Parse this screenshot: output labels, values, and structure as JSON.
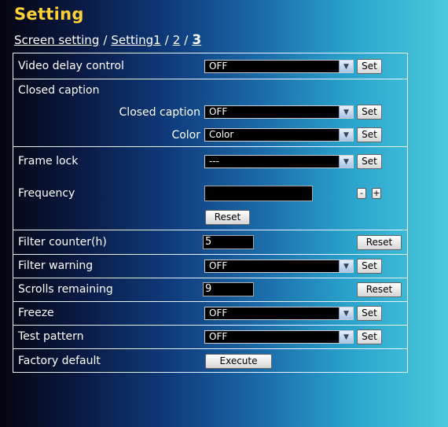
{
  "header": {
    "title": "Setting",
    "breadcrumb": {
      "link1": "Screen setting",
      "sep1": "/",
      "link2": "Setting1",
      "sep2": "/",
      "link3": "2",
      "sep3": "/",
      "current": "3"
    }
  },
  "rows": {
    "video_delay": {
      "label": "Video delay control",
      "value": "OFF",
      "set": "Set"
    },
    "closed_caption": {
      "label": "Closed caption",
      "sub_cc": {
        "label": "Closed caption",
        "value": "OFF",
        "set": "Set"
      },
      "sub_color": {
        "label": "Color",
        "value": "Color",
        "set": "Set"
      }
    },
    "frame_lock": {
      "label": "Frame lock",
      "value": "---",
      "set": "Set"
    },
    "frequency": {
      "label": "Frequency",
      "value": "",
      "minus": "-",
      "plus": "+",
      "reset": "Reset"
    },
    "filter_counter": {
      "label": "Filter counter(h)",
      "value": "5",
      "reset": "Reset"
    },
    "filter_warning": {
      "label": "Filter warning",
      "value": "OFF",
      "set": "Set"
    },
    "scrolls_remaining": {
      "label": "Scrolls remaining",
      "value": "9",
      "reset": "Reset"
    },
    "freeze": {
      "label": "Freeze",
      "value": "OFF",
      "set": "Set"
    },
    "test_pattern": {
      "label": "Test pattern",
      "value": "OFF",
      "set": "Set"
    },
    "factory_default": {
      "label": "Factory default",
      "execute": "Execute"
    }
  },
  "icons": {
    "dropdown": "chevron-down-icon"
  }
}
